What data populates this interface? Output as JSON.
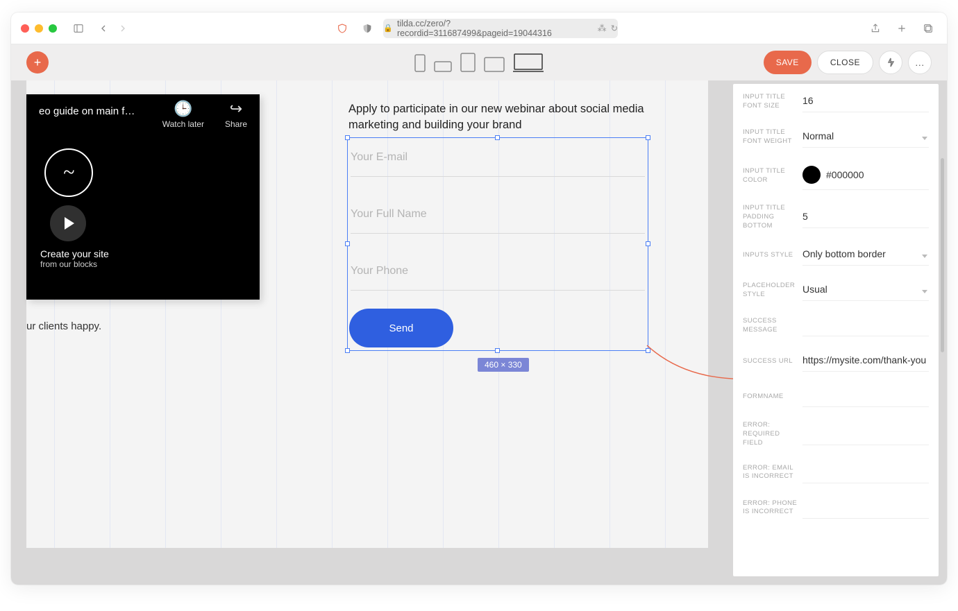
{
  "browser": {
    "url": "tilda.cc/zero/?recordid=311687499&pageid=19044316"
  },
  "header": {
    "save": "SAVE",
    "close": "CLOSE",
    "more": "…"
  },
  "video": {
    "title": "eo guide on main f…",
    "watch_later": "Watch later",
    "share": "Share",
    "caption_line1": "Create your site",
    "caption_line2": "from our blocks"
  },
  "canvas": {
    "caption": "ur clients happy.",
    "form_heading": "Apply to participate in our new webinar about social media marketing and building your brand",
    "placeholders": {
      "email": "Your E-mail",
      "name": "Your Full Name",
      "phone": "Your Phone"
    },
    "send": "Send",
    "dimensions": "460 × 330"
  },
  "panel": {
    "rows": [
      {
        "label": "INPUT TITLE FONT SIZE",
        "value": "16",
        "type": "text"
      },
      {
        "label": "INPUT TITLE FONT WEIGHT",
        "value": "Normal",
        "type": "select"
      },
      {
        "label": "INPUT TITLE COLOR",
        "value": "#000000",
        "type": "color"
      },
      {
        "label": "INPUT TITLE PADDING BOTTOM",
        "value": "5",
        "type": "text"
      },
      {
        "label": "INPUTS STYLE",
        "value": "Only bottom border",
        "type": "select"
      },
      {
        "label": "PLACEHOLDER STYLE",
        "value": "Usual",
        "type": "select"
      },
      {
        "label": "SUCCESS MESSAGE",
        "value": "",
        "type": "text"
      },
      {
        "label": "SUCCESS URL",
        "value": "https://mysite.com/thank-you",
        "type": "text"
      },
      {
        "label": "FORMNAME",
        "value": "",
        "type": "text"
      },
      {
        "label": "ERROR: REQUIRED FIELD",
        "value": "",
        "type": "text"
      },
      {
        "label": "ERROR: EMAIL IS INCORRECT",
        "value": "",
        "type": "text"
      },
      {
        "label": "ERROR: PHONE IS INCORRECT",
        "value": "",
        "type": "text"
      }
    ]
  }
}
